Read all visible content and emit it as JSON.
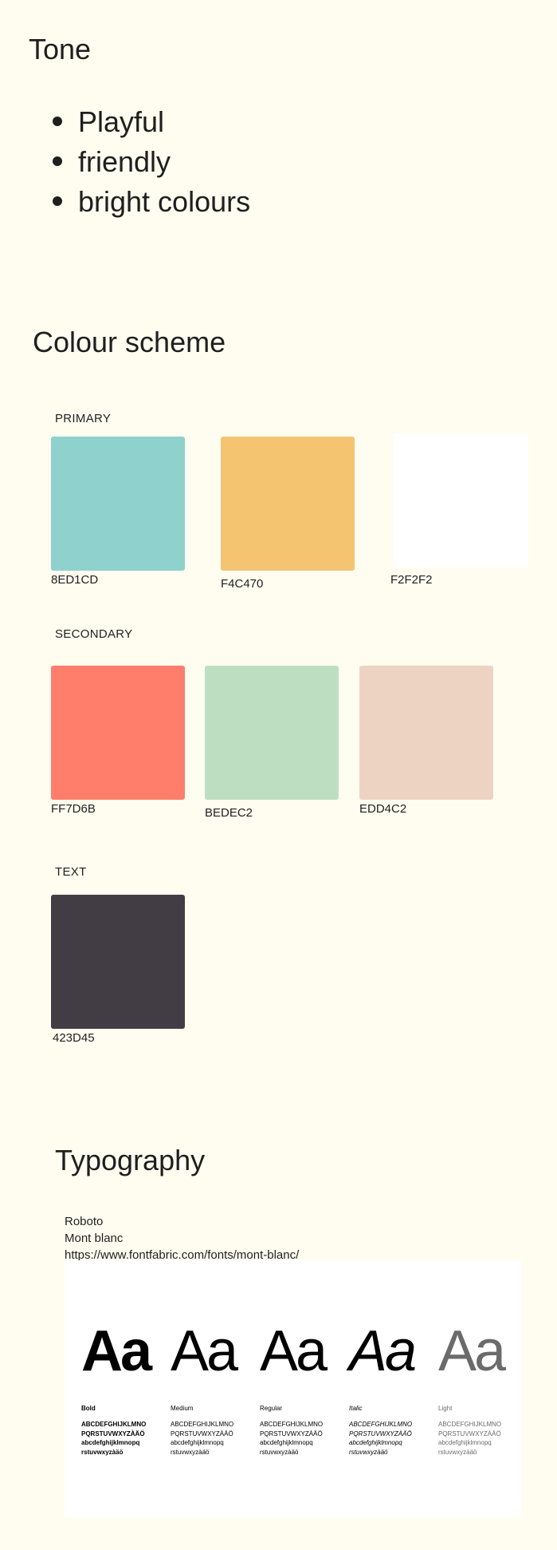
{
  "tone": {
    "title": "Tone",
    "items": [
      "Playful",
      "friendly",
      "bright colours"
    ]
  },
  "colour_scheme": {
    "title": "Colour scheme",
    "primary": {
      "label": "PRIMARY",
      "swatches": [
        {
          "code": "8ED1CD",
          "color": "#8ED1CD"
        },
        {
          "code": "F4C470",
          "color": "#F4C470"
        },
        {
          "code": "F2F2F2",
          "color": "#FFFFFF"
        }
      ]
    },
    "secondary": {
      "label": "SECONDARY",
      "swatches": [
        {
          "code": "FF7D6B",
          "color": "#FF7D6B"
        },
        {
          "code": "BEDEC2",
          "color": "#BEDEC2"
        },
        {
          "code": "EDD4C2",
          "color": "#EDD4C2"
        }
      ]
    },
    "text": {
      "label": "TEXT",
      "swatches": [
        {
          "code": "423D45",
          "color": "#423D45"
        }
      ]
    }
  },
  "typography": {
    "title": "Typography",
    "font_primary": "Roboto",
    "font_secondary": "Mont blanc",
    "font_link": "https://www.fontfabric.com/fonts/mont-blanc/",
    "specimen": {
      "glyph": "Aa",
      "weights": [
        {
          "name": "Bold",
          "weight": "700",
          "style": "normal",
          "color": "#000000",
          "sample": "ABCDEFGHIJKLMNO\nPQRSTUVWXYZÀÄÖ\nabcdefghijklmnopq\nrstuvwxyzàäö"
        },
        {
          "name": "Medium",
          "weight": "500",
          "style": "normal",
          "color": "#000000",
          "sample": "ABCDEFGHIJKLMNO\nPQRSTUVWXYZÀÄÖ\nabcdefghijklmnopq\nrstuvwxyzàäö"
        },
        {
          "name": "Regular",
          "weight": "400",
          "style": "normal",
          "color": "#000000",
          "sample": "ABCDEFGHIJKLMNO\nPQRSTUVWXYZÀÄÖ\nabcdefghijklmnopq\nrstuvwxyzàäö"
        },
        {
          "name": "Italic",
          "weight": "400",
          "style": "italic",
          "color": "#000000",
          "sample": "ABCDEFGHIJKLMNO\nPQRSTUVWXYZÀÄÖ\nabcdefghijklmnopq\nrstuvwxyzàäö"
        },
        {
          "name": "Light",
          "weight": "300",
          "style": "normal",
          "color": "#6b6b6b",
          "sample": "ABCDEFGHIJKLMNO\nPQRSTUVWXYZÀÄÖ\nabcdefghijklmnopq\nrstuvwxyzàäö"
        }
      ]
    }
  }
}
